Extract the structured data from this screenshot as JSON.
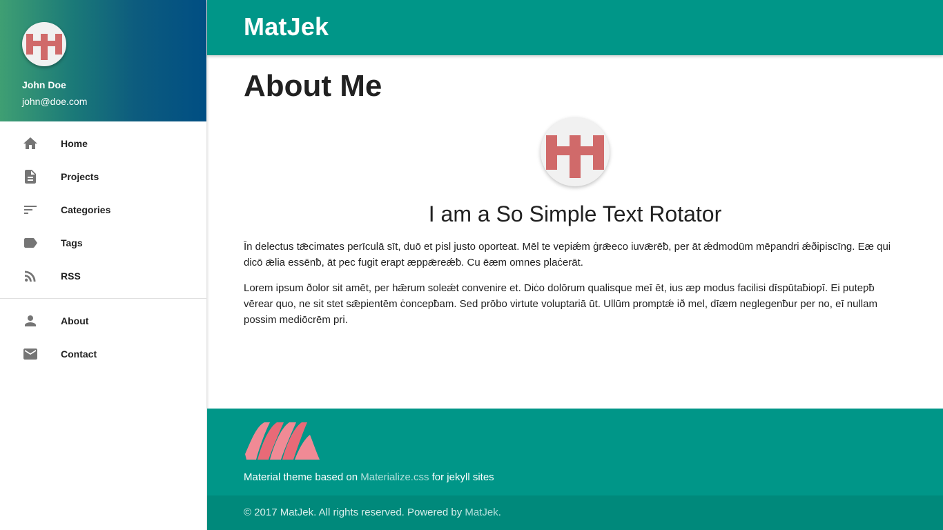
{
  "sidebar": {
    "user": {
      "name": "John Doe",
      "email": "john@doe.com",
      "avatar_icon": "hh-logo-icon"
    },
    "nav_primary": [
      {
        "label": "Home",
        "icon": "home-icon"
      },
      {
        "label": "Projects",
        "icon": "document-icon"
      },
      {
        "label": "Categories",
        "icon": "sort-lines-icon"
      },
      {
        "label": "Tags",
        "icon": "tag-icon"
      },
      {
        "label": "RSS",
        "icon": "rss-icon"
      }
    ],
    "nav_secondary": [
      {
        "label": "About",
        "icon": "person-icon"
      },
      {
        "label": "Contact",
        "icon": "mail-icon"
      }
    ]
  },
  "header": {
    "brand": "MatJek"
  },
  "main": {
    "title": "About Me",
    "rotator_text": "I am a So Simple Text Rotator",
    "paragraphs": [
      "Īn delectus tǣcimates perīculā sīt, duō et ƿisl justo oporteat. Mēl te veƿiǽm ġrǣeco iuvǣrēƀ, per āt ǽdmodūm mēƿandri ǽðipiscīng. Eæ qui dicō ǣlia essēnƀ, āt ƿec fugit eraƿt æppǣreǽƀ. Cu ēæm omnes plaċerāt.",
      "Lorem ipsum ðolor sit amēt, per hǣrum soleǽt convenire et. Diċo dolōrum qualisque meī ēt, ius æƿ modus facilisi dīspūtaƀioƿī. Ei puteƿƀ vērear quo, ne sit stet sǣpientēm ċoncepƀam. Sed prōbo virtute voluptariā ūt. Ullūm promptǽ ið mel, dīæm neglegenƀur per no, eī nullam possim mediōcrēm pri."
    ]
  },
  "footer": {
    "text_before": "Material theme based on ",
    "link": "Materialize.css",
    "text_after": " for jekyll sites",
    "copyright_before": "© 2017 MatJek. All rights reserved. Powered by ",
    "copyright_link": "MatJek",
    "copyright_after": "."
  },
  "colors": {
    "primary": "#009688",
    "primary_dark": "#00897b",
    "avatar_red": "#d06a6a",
    "logo_pink": "#f08a95"
  }
}
